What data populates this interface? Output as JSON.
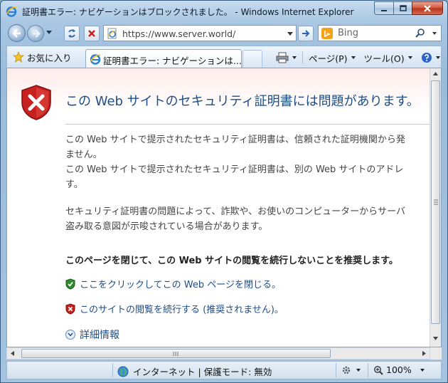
{
  "window": {
    "title": "証明書エラー: ナビゲーションはブロックされました。 - Windows Internet Explorer",
    "minimize_label": "Minimize",
    "maximize_label": "Maximize",
    "close_label": "Close"
  },
  "address_bar": {
    "url": "https://www.server.world/"
  },
  "search": {
    "placeholder": "Bing"
  },
  "favorites": {
    "label": "お気に入り"
  },
  "tab": {
    "label": "証明書エラー: ナビゲーションは..."
  },
  "command_bar": {
    "page_label": "ページ(P)",
    "tools_label": "ツール(O)"
  },
  "content": {
    "heading": "この Web サイトのセキュリティ証明書には問題があります。",
    "para1_lines": [
      "この Web サイトで提示されたセキュリティ証明書は、信頼された証明機関から発",
      "ません。",
      "この Web サイトで提示されたセキュリティ証明書は、別の Web サイトのアドレ",
      "す。"
    ],
    "para2_lines": [
      "セキュリティ証明書の問題によって、詐欺や、お使いのコンピューターからサーバ",
      "盗み取る意図が示唆されている場合があります。"
    ],
    "recommendation": "このページを閉じて、この Web サイトの閲覧を続行しないことを推奨します。",
    "close_link": "ここをクリックしてこの Web ページを閉じる。",
    "continue_link": "このサイトの閲覧を続行する (推奨されません)。",
    "more_info": "詳細情報"
  },
  "status_bar": {
    "zone": "インターネット | 保護モード: 無効",
    "zoom": "100%"
  },
  "icons": {
    "ie": "internet-explorer-icon",
    "shield_error": "shield-error-icon",
    "shield_ok": "shield-ok-icon",
    "globe": "globe-icon"
  },
  "colors": {
    "heading": "#1f4e86",
    "link": "#1f4e86",
    "error_red": "#c8201e",
    "ok_green": "#2e8b2e"
  }
}
